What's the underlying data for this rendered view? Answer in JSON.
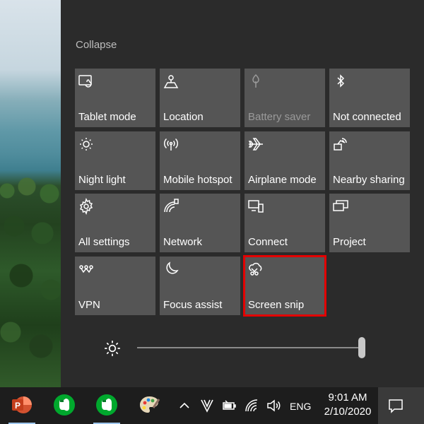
{
  "action_center": {
    "collapse_label": "Collapse",
    "tiles": [
      {
        "label": "Tablet mode",
        "icon": "tablet-mode-icon",
        "enabled": true
      },
      {
        "label": "Location",
        "icon": "location-icon",
        "enabled": true
      },
      {
        "label": "Battery saver",
        "icon": "battery-saver-icon",
        "enabled": false
      },
      {
        "label": "Not connected",
        "icon": "bluetooth-icon",
        "enabled": true
      },
      {
        "label": "Night light",
        "icon": "night-light-icon",
        "enabled": true
      },
      {
        "label": "Mobile hotspot",
        "icon": "mobile-hotspot-icon",
        "enabled": true
      },
      {
        "label": "Airplane mode",
        "icon": "airplane-icon",
        "enabled": true
      },
      {
        "label": "Nearby sharing",
        "icon": "nearby-sharing-icon",
        "enabled": true
      },
      {
        "label": "All settings",
        "icon": "gear-icon",
        "enabled": true
      },
      {
        "label": "Network",
        "icon": "network-icon",
        "enabled": true
      },
      {
        "label": "Connect",
        "icon": "connect-icon",
        "enabled": true
      },
      {
        "label": "Project",
        "icon": "project-icon",
        "enabled": true
      },
      {
        "label": "VPN",
        "icon": "vpn-icon",
        "enabled": true
      },
      {
        "label": "Focus assist",
        "icon": "moon-icon",
        "enabled": true
      },
      {
        "label": "Screen snip",
        "icon": "screen-snip-icon",
        "enabled": true,
        "highlighted": true
      }
    ],
    "brightness_level": 1.0
  },
  "taskbar": {
    "apps": [
      {
        "name": "PowerPoint",
        "icon": "powerpoint-icon",
        "active": true
      },
      {
        "name": "Evernote",
        "icon": "evernote-icon",
        "active": false
      },
      {
        "name": "Evernote",
        "icon": "evernote-icon",
        "active": true
      },
      {
        "name": "Paint",
        "icon": "paint-palette-icon",
        "active": false
      }
    ],
    "language": "ENG",
    "time": "9:01 AM",
    "date": "2/10/2020"
  },
  "colors": {
    "panel_bg": "#2b2b2b",
    "tile_bg": "#555555",
    "highlight": "#e30000",
    "taskbar_bg": "#1d1d1d"
  }
}
